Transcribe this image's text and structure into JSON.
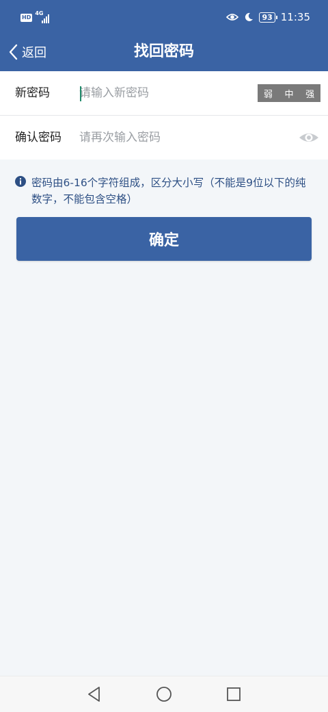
{
  "status_bar": {
    "hd_badge": "HD",
    "network": "4G",
    "battery": "93",
    "time": "11:35",
    "icons": [
      "eye-comfort-icon",
      "moon-icon"
    ]
  },
  "header": {
    "back_label": "返回",
    "title": "找回密码",
    "bg_color": "#3a63a4"
  },
  "form": {
    "new_password": {
      "label": "新密码",
      "placeholder": "请输入新密码",
      "value": "",
      "strength_levels": [
        "弱",
        "中",
        "强"
      ]
    },
    "confirm_password": {
      "label": "确认密码",
      "placeholder": "请再次输入密码",
      "value": "",
      "toggle_icon": "eye-icon"
    }
  },
  "hint": {
    "text": "密码由6-16个字符组成，区分大小写（不能是9位以下的纯数字，不能包含空格）",
    "icon": "info-icon"
  },
  "confirm_button": {
    "label": "确定"
  },
  "nav_bar": {
    "buttons": [
      "back-triangle-icon",
      "home-circle-icon",
      "recents-square-icon"
    ]
  }
}
